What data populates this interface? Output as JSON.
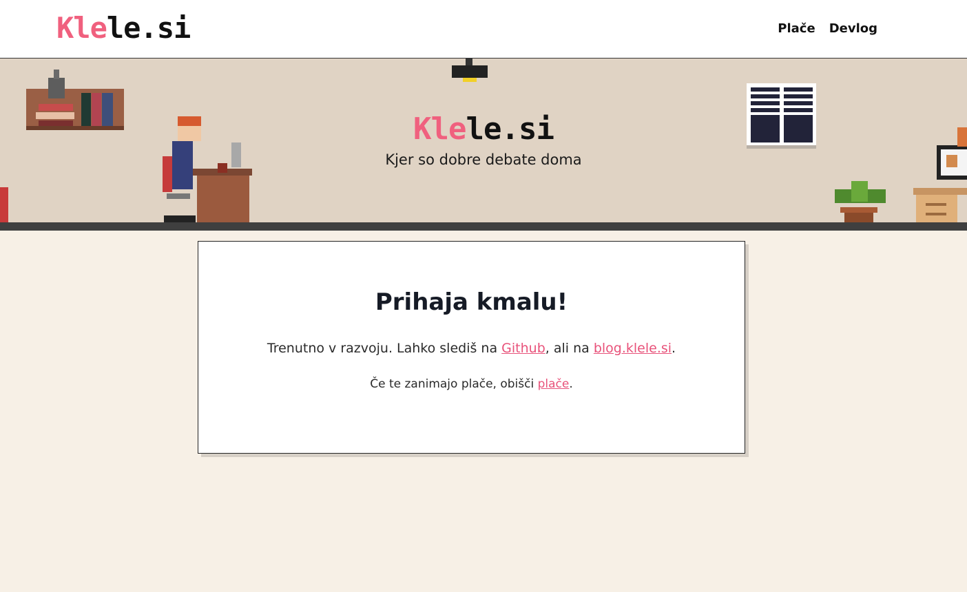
{
  "header": {
    "logo_pink": "Kle",
    "logo_dark": "le.si",
    "nav": [
      {
        "label": "Plače"
      },
      {
        "label": "Devlog"
      }
    ]
  },
  "hero": {
    "title_pink": "Kle",
    "title_dark": "le.si",
    "subtitle": "Kjer so dobre debate doma"
  },
  "card": {
    "heading": "Prihaja kmalu!",
    "line1_prefix": "Trenutno v razvoju. Lahko slediš na ",
    "line1_link1": "Github",
    "line1_middle": ", ali na ",
    "line1_link2": "blog.klele.si",
    "line1_suffix": ".",
    "line2_prefix": "Če te zanimajo plače, obišči ",
    "line2_link": "plače",
    "line2_suffix": "."
  },
  "colors": {
    "accent": "#f0607e",
    "link": "#e8527a",
    "page_bg": "#f7f0e6",
    "hero_bg": "#e0d3c4"
  }
}
